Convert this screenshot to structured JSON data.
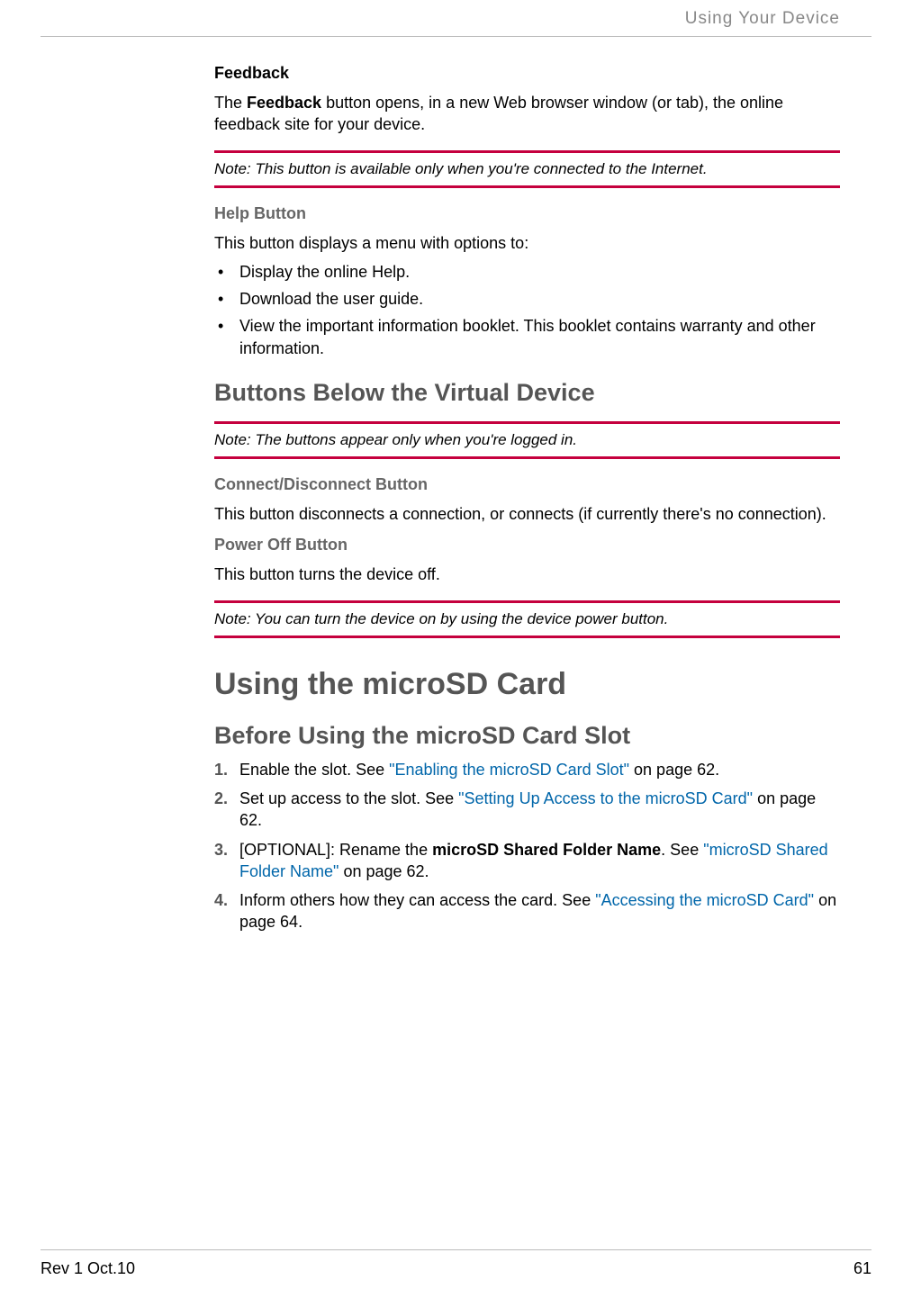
{
  "header": {
    "section_title": "Using Your Device"
  },
  "feedback": {
    "heading": "Feedback",
    "p1_pre": "The ",
    "p1_bold": "Feedback",
    "p1_post": " button opens, in a new Web browser window (or tab), the online feedback site for your device.",
    "note": "Note:  This button is available only when you're connected to the Internet."
  },
  "help": {
    "heading": "Help Button",
    "intro": "This button displays a menu with options to:",
    "items": [
      "Display the online Help.",
      "Download the user guide.",
      "View the important information booklet. This booklet contains warranty and other information."
    ]
  },
  "buttons_below": {
    "heading": "Buttons Below the Virtual Device",
    "note": "Note:  The buttons appear only when you're logged in."
  },
  "connect": {
    "heading": "Connect/Disconnect Button",
    "text": "This button disconnects a connection, or connects (if currently there's no connection)."
  },
  "power": {
    "heading": "Power Off Button",
    "text": "This button turns the device off.",
    "note": "Note:  You can turn the device on by using the device power button."
  },
  "microsd": {
    "heading": "Using the microSD Card",
    "sub": "Before Using the microSD Card Slot",
    "steps": {
      "s1_pre": "Enable the slot. See ",
      "s1_link": "\"Enabling the microSD Card Slot\"",
      "s1_post": " on page 62.",
      "s2_pre": "Set up access to the slot. See ",
      "s2_link": "\"Setting Up Access to the microSD Card\"",
      "s2_post": " on page 62.",
      "s3_pre": "[OPTIONAL]: Rename the ",
      "s3_bold": "microSD Shared Folder Name",
      "s3_mid": ". See ",
      "s3_link": "\"microSD Shared Folder Name\"",
      "s3_post": " on page 62.",
      "s4_pre": "Inform others how they can access the card. See ",
      "s4_link": "\"Accessing the microSD Card\"",
      "s4_post": " on page 64."
    }
  },
  "footer": {
    "rev": "Rev 1  Oct.10",
    "page": "61"
  }
}
